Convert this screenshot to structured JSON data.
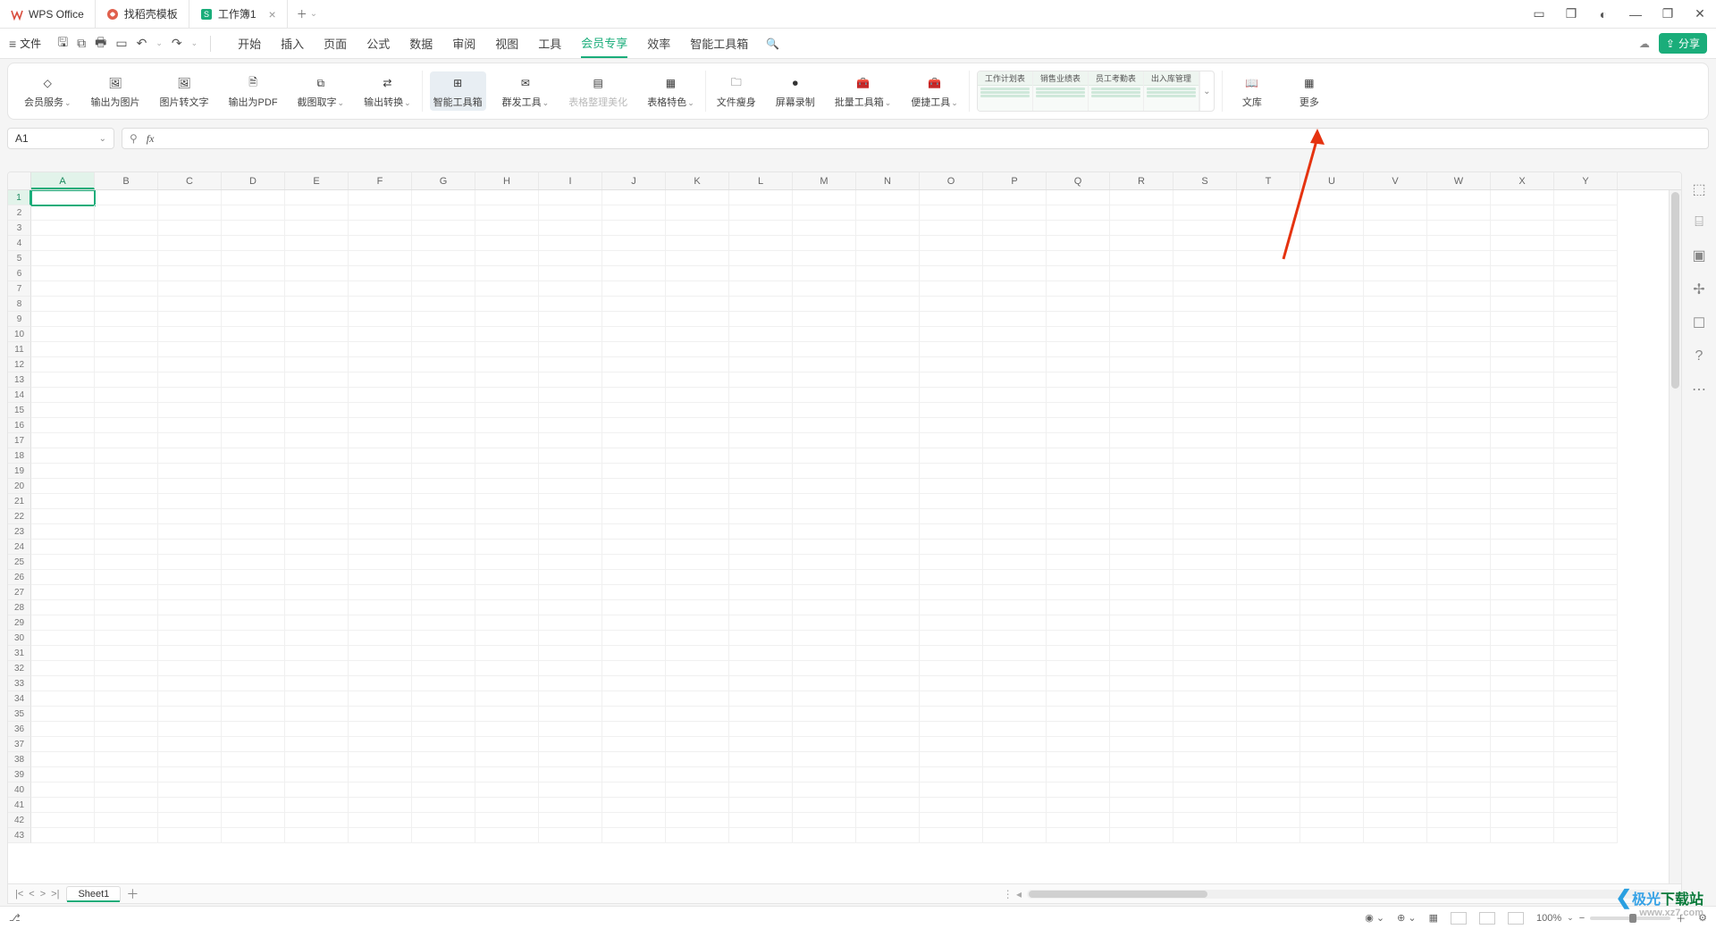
{
  "app": {
    "name": "WPS Office"
  },
  "tabs": [
    {
      "label": "WPS Office",
      "icon": "w",
      "color": "#d94b3b"
    },
    {
      "label": "找稻壳模板",
      "icon": "d",
      "color": "#e0604d"
    },
    {
      "label": "工作簿1",
      "icon": "s",
      "color": "#1aad7a",
      "active": true
    }
  ],
  "menu": {
    "file": "文件",
    "items": [
      "开始",
      "插入",
      "页面",
      "公式",
      "数据",
      "审阅",
      "视图",
      "工具",
      "会员专享",
      "效率",
      "智能工具箱"
    ],
    "active": "会员专享",
    "share": "分享"
  },
  "ribbon": {
    "buttons": [
      {
        "id": "member",
        "label": "会员服务",
        "caret": true
      },
      {
        "id": "out-img",
        "label": "输出为图片"
      },
      {
        "id": "img2txt",
        "label": "图片转文字"
      },
      {
        "id": "out-pdf",
        "label": "输出为PDF"
      },
      {
        "id": "snip",
        "label": "截图取字",
        "caret": true
      },
      {
        "id": "out-conv",
        "label": "输出转换",
        "caret": true
      },
      {
        "id": "smart",
        "label": "智能工具箱",
        "active": true
      },
      {
        "id": "mass",
        "label": "群发工具",
        "caret": true
      },
      {
        "id": "beautify",
        "label": "表格整理美化",
        "muted": true
      },
      {
        "id": "theme",
        "label": "表格特色",
        "caret": true
      },
      {
        "id": "slim",
        "label": "文件瘦身"
      },
      {
        "id": "record",
        "label": "屏幕录制"
      },
      {
        "id": "batch",
        "label": "批量工具箱",
        "caret": true
      },
      {
        "id": "handy",
        "label": "便捷工具",
        "caret": true
      }
    ],
    "templates": [
      "工作计划表",
      "销售业绩表",
      "员工考勤表",
      "出入库管理"
    ],
    "tail": [
      {
        "id": "wenku",
        "label": "文库"
      },
      {
        "id": "more",
        "label": "更多"
      }
    ]
  },
  "namebox": "A1",
  "columns": [
    "A",
    "B",
    "C",
    "D",
    "E",
    "F",
    "G",
    "H",
    "I",
    "J",
    "K",
    "L",
    "M",
    "N",
    "O",
    "P",
    "Q",
    "R",
    "S",
    "T",
    "U",
    "V",
    "W",
    "X",
    "Y"
  ],
  "rows": 43,
  "sel": {
    "col": "A",
    "row": 1
  },
  "sheet": {
    "name": "Sheet1"
  },
  "status": {
    "zoom": "100%"
  },
  "watermark": {
    "brand1": "极光",
    "brand2": "下载站",
    "url": "www.xz7.com"
  }
}
